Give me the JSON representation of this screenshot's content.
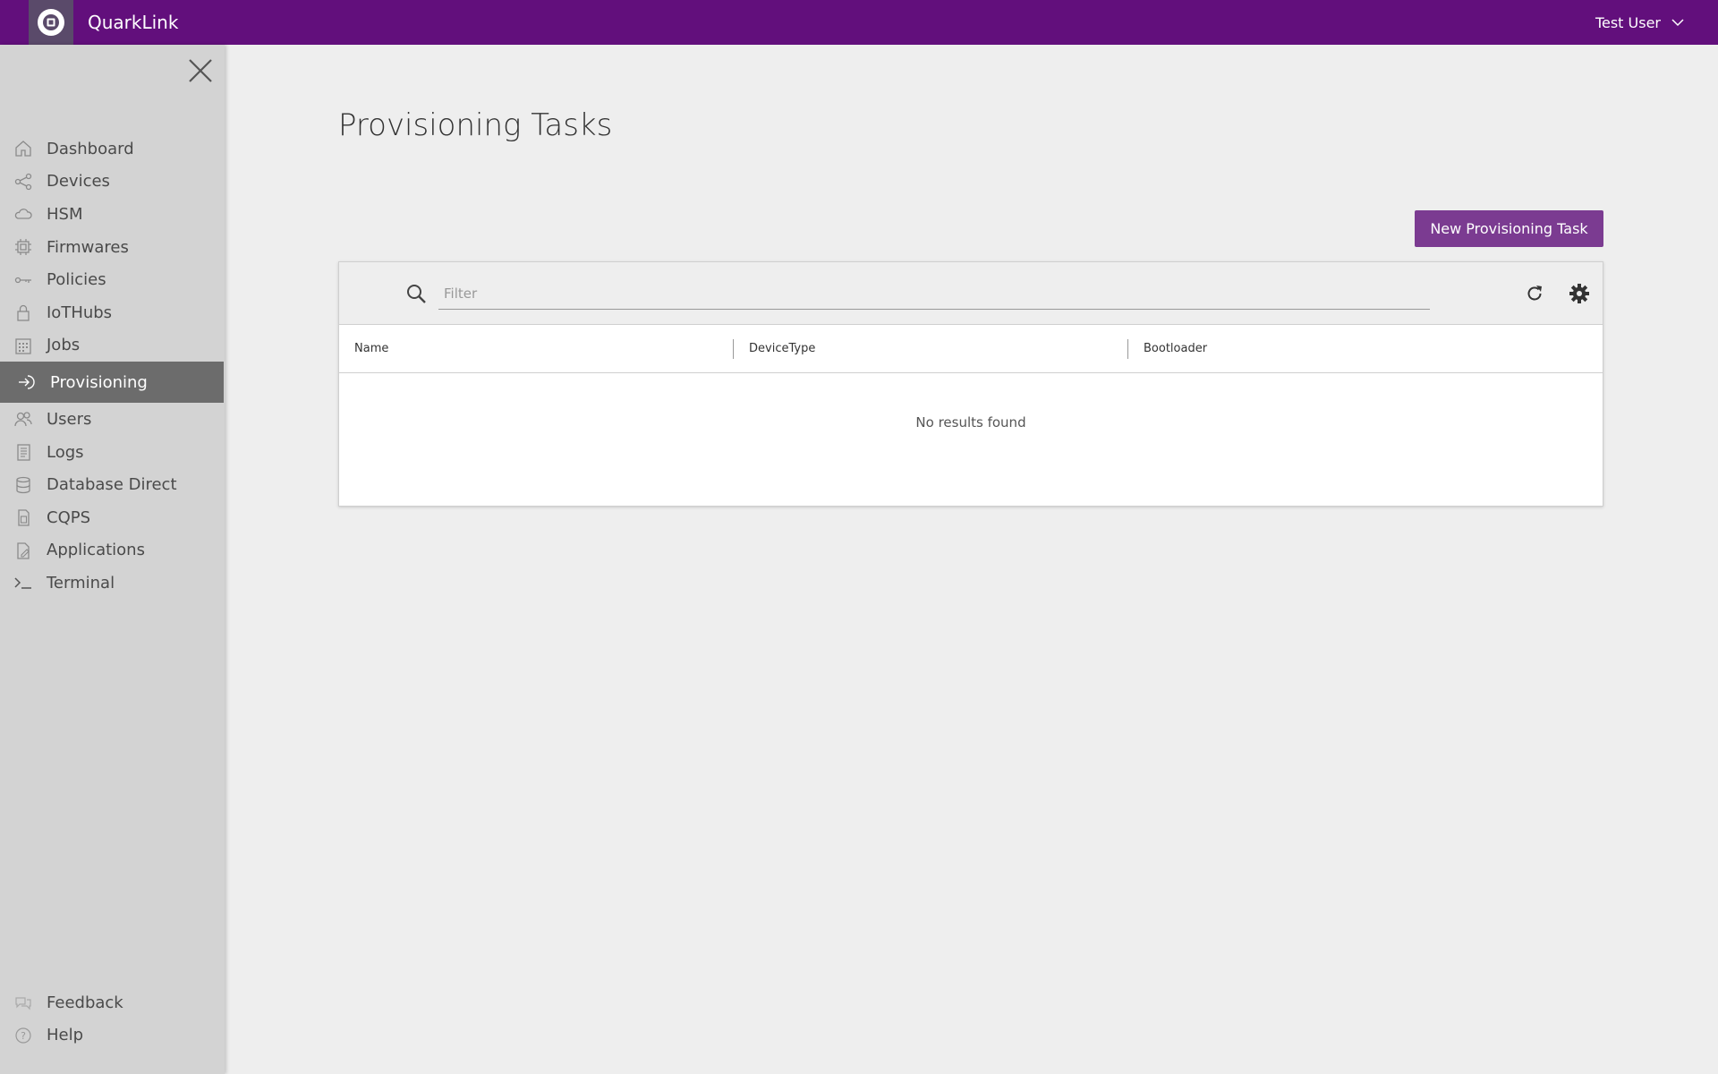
{
  "header": {
    "app_name": "QuarkLink",
    "logo_icon": "gear-chip-logo",
    "user_name": "Test User",
    "brand_color": "#620f7c"
  },
  "sidebar": {
    "items": [
      {
        "label": "Dashboard",
        "icon": "home-icon"
      },
      {
        "label": "Devices",
        "icon": "share-icon"
      },
      {
        "label": "HSM",
        "icon": "cloud-icon"
      },
      {
        "label": "Firmwares",
        "icon": "chip-icon"
      },
      {
        "label": "Policies",
        "icon": "key-icon"
      },
      {
        "label": "IoTHubs",
        "icon": "lock-icon"
      },
      {
        "label": "Jobs",
        "icon": "calendar-icon"
      },
      {
        "label": "Provisioning",
        "icon": "sign-in-icon",
        "active": true
      },
      {
        "label": "Users",
        "icon": "users-icon"
      },
      {
        "label": "Logs",
        "icon": "document-icon"
      },
      {
        "label": "Database Direct",
        "icon": "database-icon"
      },
      {
        "label": "CQPS",
        "icon": "sim-card-icon"
      },
      {
        "label": "Applications",
        "icon": "file-edit-icon"
      },
      {
        "label": "Terminal",
        "icon": "terminal-icon"
      }
    ],
    "bottom_items": [
      {
        "label": "Feedback",
        "icon": "chat-icon"
      },
      {
        "label": "Help",
        "icon": "question-icon"
      }
    ]
  },
  "main": {
    "title": "Provisioning Tasks",
    "new_button_label": "New Provisioning Task",
    "accent_color": "#7b3b91",
    "filter_placeholder": "Filter",
    "filter_value": "",
    "columns": [
      "Name",
      "DeviceType",
      "Bootloader"
    ],
    "empty_message": "No results found"
  }
}
